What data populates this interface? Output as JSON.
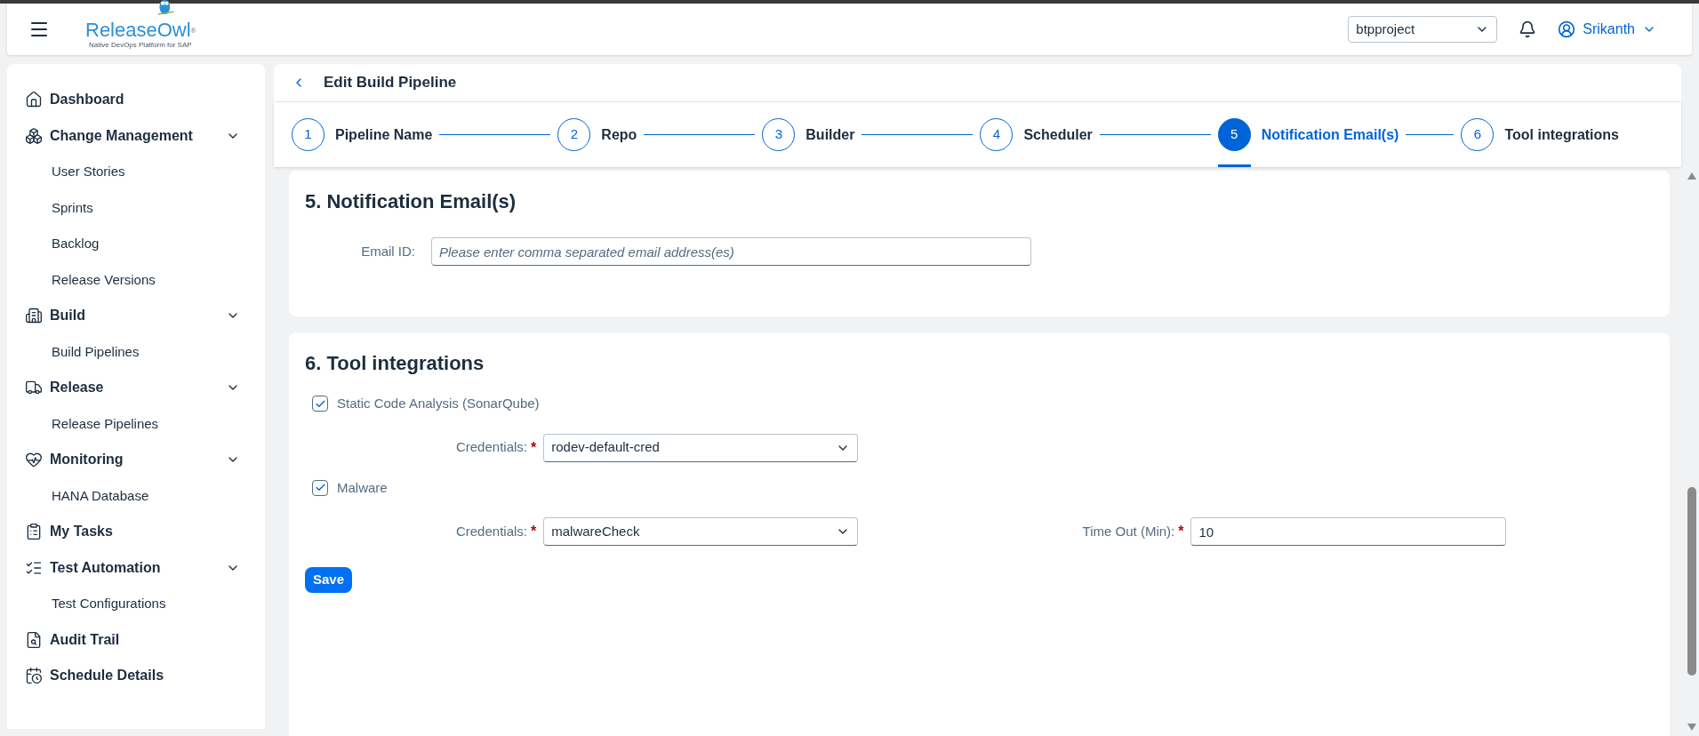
{
  "header": {
    "logo": {
      "name": "ReleaseOwl",
      "mark": "®",
      "tagline": "Native DevOps Platform for SAP"
    },
    "project_select": {
      "value": "btpproject"
    },
    "user": {
      "name": "Srikanth"
    }
  },
  "sidebar": {
    "items": [
      {
        "label": "Dashboard",
        "kind": "link"
      },
      {
        "label": "Change Management",
        "kind": "group",
        "expanded": true,
        "children": [
          {
            "label": "User Stories"
          },
          {
            "label": "Sprints"
          },
          {
            "label": "Backlog"
          },
          {
            "label": "Release Versions"
          }
        ]
      },
      {
        "label": "Build",
        "kind": "group",
        "expanded": true,
        "children": [
          {
            "label": "Build Pipelines"
          }
        ]
      },
      {
        "label": "Release",
        "kind": "group",
        "expanded": true,
        "children": [
          {
            "label": "Release Pipelines"
          }
        ]
      },
      {
        "label": "Monitoring",
        "kind": "group",
        "expanded": true,
        "children": [
          {
            "label": "HANA Database"
          }
        ]
      },
      {
        "label": "My Tasks",
        "kind": "link"
      },
      {
        "label": "Test Automation",
        "kind": "group",
        "expanded": true,
        "children": [
          {
            "label": "Test Configurations"
          }
        ]
      },
      {
        "label": "Audit Trail",
        "kind": "link"
      },
      {
        "label": "Schedule Details",
        "kind": "link"
      }
    ]
  },
  "page": {
    "title": "Edit Build Pipeline"
  },
  "steps": [
    {
      "number": "1",
      "label": "Pipeline Name",
      "selected": false
    },
    {
      "number": "2",
      "label": "Repo",
      "selected": false
    },
    {
      "number": "3",
      "label": "Builder",
      "selected": false
    },
    {
      "number": "4",
      "label": "Scheduler",
      "selected": false
    },
    {
      "number": "5",
      "label": "Notification Email(s)",
      "selected": true
    },
    {
      "number": "6",
      "label": "Tool integrations",
      "selected": false
    }
  ],
  "email_section": {
    "heading": "5. Notification Email(s)",
    "field": {
      "label": "Email ID:",
      "placeholder": "Please enter comma separated email address(es)"
    }
  },
  "tools_section": {
    "heading": "6. Tool integrations",
    "integrations": [
      {
        "label": "Static Code Analysis (SonarQube)",
        "checked": true,
        "fields": [
          {
            "kind": "select",
            "label": "Credentials:",
            "required_mark": "*",
            "value": "rodev-default-cred"
          }
        ]
      },
      {
        "label": "Malware",
        "checked": true,
        "fields": [
          {
            "kind": "select",
            "label": "Credentials:",
            "required_mark": "*",
            "value": "malwareCheck"
          },
          {
            "kind": "input",
            "label": "Time Out (Min):",
            "required_mark": "*",
            "value": "10"
          }
        ]
      }
    ],
    "save_button": "Save"
  }
}
